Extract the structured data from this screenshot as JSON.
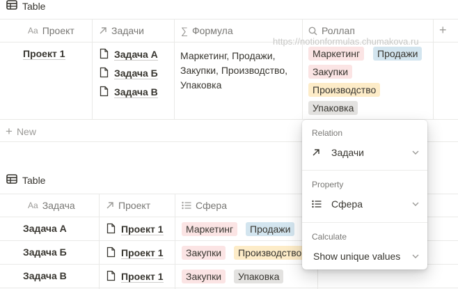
{
  "table1": {
    "title": "Table",
    "headers": {
      "project": "Проект",
      "tasks": "Задачи",
      "formula": "Формула",
      "rollup": "Роллап"
    },
    "row": {
      "project": "Проект 1",
      "tasks": [
        "Задача А",
        "Задача Б",
        "Задача В"
      ],
      "formula_lines": [
        "Маркетинг, Продажи,",
        "Закупки, Производство,",
        "Упаковка"
      ],
      "rollup_tags": [
        {
          "label": "Маркетинг",
          "color": "#fbe4e4"
        },
        {
          "label": "Продажи",
          "color": "#d3e5ef"
        },
        {
          "label": "Закупки",
          "color": "#fbe4e4"
        },
        {
          "label": "Производство",
          "color": "#fdecc8"
        },
        {
          "label": "Упаковка",
          "color": "#e3e2e0"
        }
      ]
    },
    "new_label": "New"
  },
  "watermark": "https://notionformulas.chumakova.ru",
  "popup": {
    "relation_label": "Relation",
    "relation_value": "Задачи",
    "property_label": "Property",
    "property_value": "Сфера",
    "calculate_label": "Calculate",
    "calculate_value": "Show unique values"
  },
  "table2": {
    "title": "Table",
    "headers": {
      "task": "Задача",
      "project": "Проект",
      "sphere": "Сфера"
    },
    "rows": [
      {
        "task": "Задача А",
        "project": "Проект 1",
        "tags": [
          {
            "label": "Маркетинг"
          },
          {
            "label": "Продажи"
          }
        ]
      },
      {
        "task": "Задача Б",
        "project": "Проект 1",
        "tags": [
          {
            "label": "Закупки"
          },
          {
            "label": "Производство"
          }
        ]
      },
      {
        "task": "Задача В",
        "project": "Проект 1",
        "tags": [
          {
            "label": "Закупки"
          },
          {
            "label": "Упаковка"
          }
        ]
      }
    ]
  }
}
